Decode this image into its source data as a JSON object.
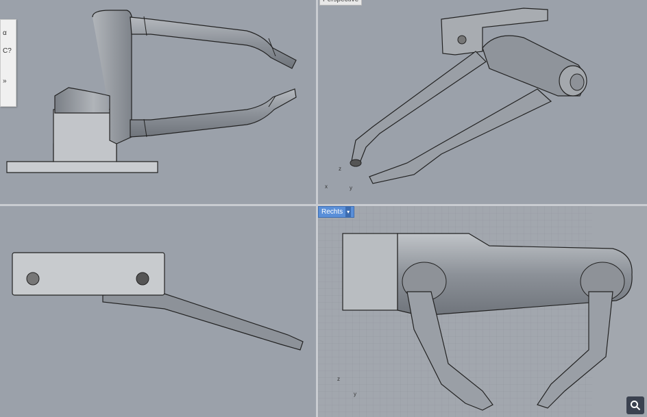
{
  "viewports": {
    "top": {
      "label": ""
    },
    "perspective": {
      "label": "Perspective"
    },
    "front": {
      "label": ""
    },
    "right": {
      "label": "Rechts",
      "dropdown_glyph": "▾"
    }
  },
  "axes": {
    "x": "x",
    "y": "y",
    "z": "z"
  },
  "left_toolbar": {
    "items": [
      "α",
      "C?",
      "»"
    ]
  },
  "icons": {
    "search": "search-icon",
    "dropdown": "chevron-down-icon"
  },
  "colors": {
    "viewport_bg": "#9ba1aa",
    "label_bg": "#5a8fd8",
    "model": "#8a8f96"
  }
}
